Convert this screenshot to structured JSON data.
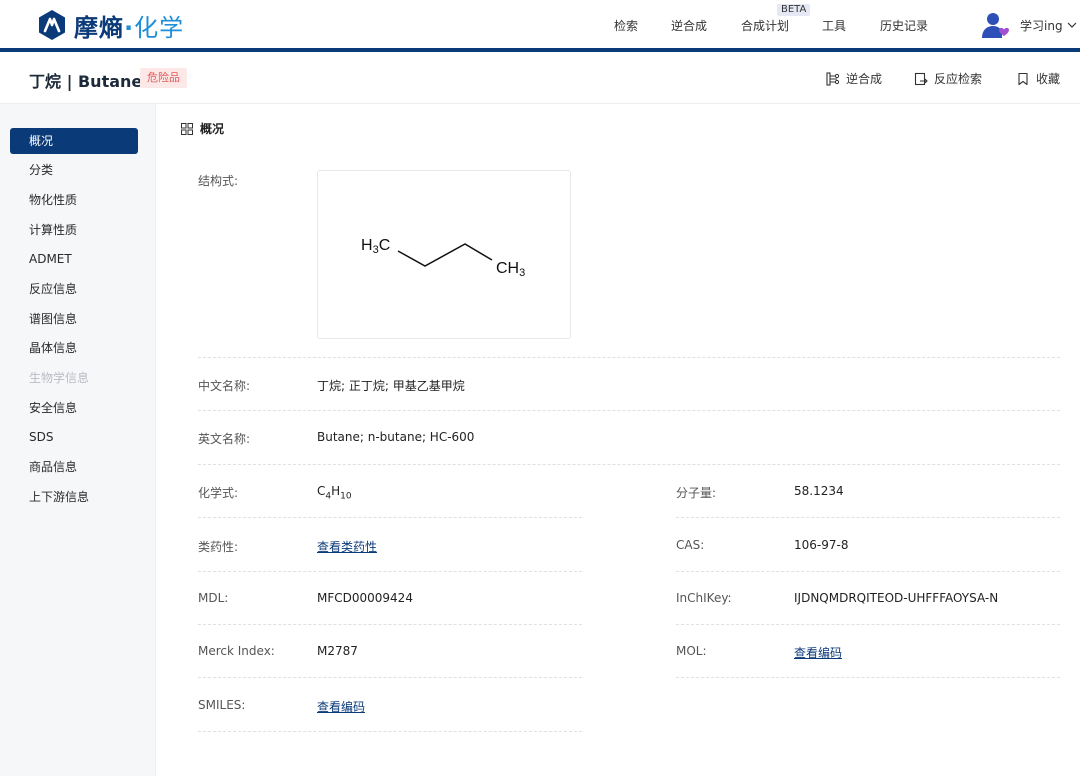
{
  "brand": {
    "name_main": "摩熵",
    "name_dot": "·",
    "name_sub": "化学",
    "colors": {
      "primary": "#0b3a78",
      "accent": "#1e8ed8"
    }
  },
  "nav": {
    "items": [
      {
        "label": "检索"
      },
      {
        "label": "逆合成"
      },
      {
        "label": "合成计划"
      },
      {
        "label": "工具"
      },
      {
        "label": "历史记录"
      }
    ],
    "beta_badge": "BETA",
    "user_name": "学习ing",
    "user_icon": "user-avatar-icon",
    "chevron_icon": "chevron-down-icon"
  },
  "header": {
    "title": "丁烷 | Butane",
    "badge": "危险品",
    "actions": [
      {
        "label": "逆合成",
        "icon": "retrosynthesis-icon"
      },
      {
        "label": "反应检索",
        "icon": "reaction-search-icon"
      },
      {
        "label": "收藏",
        "icon": "bookmark-icon"
      }
    ]
  },
  "sidebar": {
    "items": [
      {
        "label": "概况",
        "state": "active"
      },
      {
        "label": "分类",
        "state": "normal"
      },
      {
        "label": "物化性质",
        "state": "normal"
      },
      {
        "label": "计算性质",
        "state": "normal"
      },
      {
        "label": "ADMET",
        "state": "normal"
      },
      {
        "label": "反应信息",
        "state": "normal"
      },
      {
        "label": "谱图信息",
        "state": "normal"
      },
      {
        "label": "晶体信息",
        "state": "normal"
      },
      {
        "label": "生物学信息",
        "state": "disabled"
      },
      {
        "label": "安全信息",
        "state": "normal"
      },
      {
        "label": "SDS",
        "state": "normal"
      },
      {
        "label": "商品信息",
        "state": "normal"
      },
      {
        "label": "上下游信息",
        "state": "normal"
      }
    ]
  },
  "overview": {
    "section_title": "概况",
    "section_icon": "grid-icon",
    "structure_label": "结构式:",
    "structure": {
      "left_group": "H3C",
      "right_group": "CH3"
    },
    "chinese_name_label": "中文名称:",
    "chinese_name_value": "丁烷; 正丁烷; 甲基乙基甲烷",
    "english_name_label": "英文名称:",
    "english_name_value": "Butane; n-butane; HC-600",
    "formula_label": "化学式:",
    "formula": {
      "c": "C",
      "c_count": "4",
      "h": "H",
      "h_count": "10"
    },
    "mw_label": "分子量:",
    "mw_value": "58.1234",
    "druglikeness_label": "类药性:",
    "druglikeness_link": "查看类药性",
    "cas_label": "CAS:",
    "cas_value": "106-97-8",
    "mdl_label": "MDL:",
    "mdl_value": "MFCD00009424",
    "inchikey_label": "InChIKey:",
    "inchikey_value": "IJDNQMDRQITEOD-UHFFFAOYSA-N",
    "merck_label": "Merck Index:",
    "merck_value": "M2787",
    "mol_label": "MOL:",
    "mol_link": "查看编码",
    "smiles_label": "SMILES:",
    "smiles_link": "查看编码"
  }
}
